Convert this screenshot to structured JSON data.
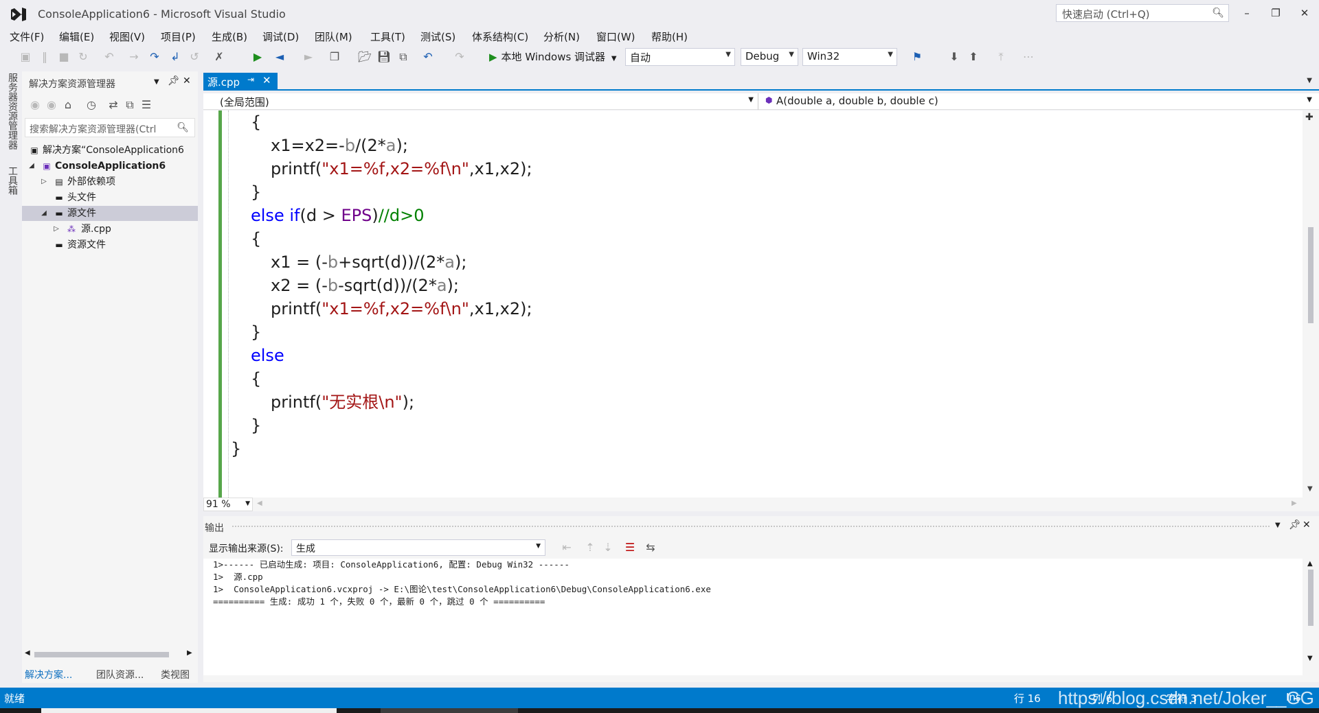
{
  "window": {
    "title": "ConsoleApplication6 - Microsoft Visual Studio",
    "quick_launch_placeholder": "快速启动 (Ctrl+Q)"
  },
  "menu": [
    "文件(F)",
    "编辑(E)",
    "视图(V)",
    "项目(P)",
    "生成(B)",
    "调试(D)",
    "团队(M)",
    "工具(T)",
    "测试(S)",
    "体系结构(C)",
    "分析(N)",
    "窗口(W)",
    "帮助(H)"
  ],
  "toolbar": {
    "run_label": "本地 Windows 调试器",
    "config_auto": "自动",
    "config_debug": "Debug",
    "platform": "Win32"
  },
  "side_tabs": [
    "服务器资源管理器",
    "工具箱"
  ],
  "solution_explorer": {
    "title": "解决方案资源管理器",
    "search_placeholder": "搜索解决方案资源管理器(Ctrl",
    "tree": [
      {
        "label": "解决方案“ConsoleApplication6",
        "icon": "solution-icon"
      },
      {
        "label": "ConsoleApplication6",
        "icon": "project-icon"
      },
      {
        "label": "外部依赖项",
        "icon": "references-icon"
      },
      {
        "label": "头文件",
        "icon": "folder-icon"
      },
      {
        "label": "源文件",
        "icon": "folder-icon"
      },
      {
        "label": "源.cpp",
        "icon": "cpp-file-icon"
      },
      {
        "label": "资源文件",
        "icon": "folder-icon"
      }
    ],
    "bottom_tabs": [
      "解决方案...",
      "团队资源...",
      "类视图"
    ]
  },
  "editor": {
    "tab_label": "源.cpp",
    "scope": "(全局范围)",
    "member": "A(double a, double b, double c)",
    "zoom": "91 %",
    "code": {
      "l1": "{",
      "l2a": "x1=x2=-",
      "l2b": "b",
      "l2c": "/(2*",
      "l2d": "a",
      "l2e": ");",
      "l3a": "printf(",
      "l3b": "\"x1=%f,x2=%f\\n\"",
      "l3c": ",x1,x2);",
      "l4": "}",
      "l5a": "else",
      "l5b": "if",
      "l5c": "(d > ",
      "l5d": "EPS",
      "l5e": ")",
      "l5f": "//d>0",
      "l6": "{",
      "l7a": "x1 = (-",
      "l7b": "b",
      "l7c": "+sqrt(d))/(2*",
      "l7d": "a",
      "l7e": ");",
      "l8a": "x2 = (-",
      "l8b": "b",
      "l8c": "-sqrt(d))/(2*",
      "l8d": "a",
      "l8e": ");",
      "l9a": "printf(",
      "l9b": "\"x1=%f,x2=%f\\n\"",
      "l9c": ",x1,x2);",
      "l10": "}",
      "l11": "else",
      "l12": "{",
      "l13a": "printf(",
      "l13b": "\"无实根\\n\"",
      "l13c": ");",
      "l14": "}",
      "l15": "}"
    }
  },
  "output": {
    "title": "输出",
    "source_label": "显示输出来源(S):",
    "source_value": "生成",
    "lines": [
      "1>------ 已启动生成: 项目: ConsoleApplication6, 配置: Debug Win32 ------",
      "1>  源.cpp",
      "1>  ConsoleApplication6.vcxproj -> E:\\图论\\test\\ConsoleApplication6\\Debug\\ConsoleApplication6.exe",
      "========== 生成: 成功 1 个，失败 0 个，最新 0 个，跳过 0 个 =========="
    ]
  },
  "status": {
    "ready": "就绪",
    "line": "行 16",
    "col": "列 6",
    "ch": "字符 3",
    "ins": "Ins",
    "watermark": "https://blog.csdn.net/Joker__GG"
  },
  "colors": {
    "accent": "#007acc",
    "keyword": "#0000ff",
    "string": "#a31515",
    "comment": "#008000",
    "macro": "#6f008a"
  }
}
